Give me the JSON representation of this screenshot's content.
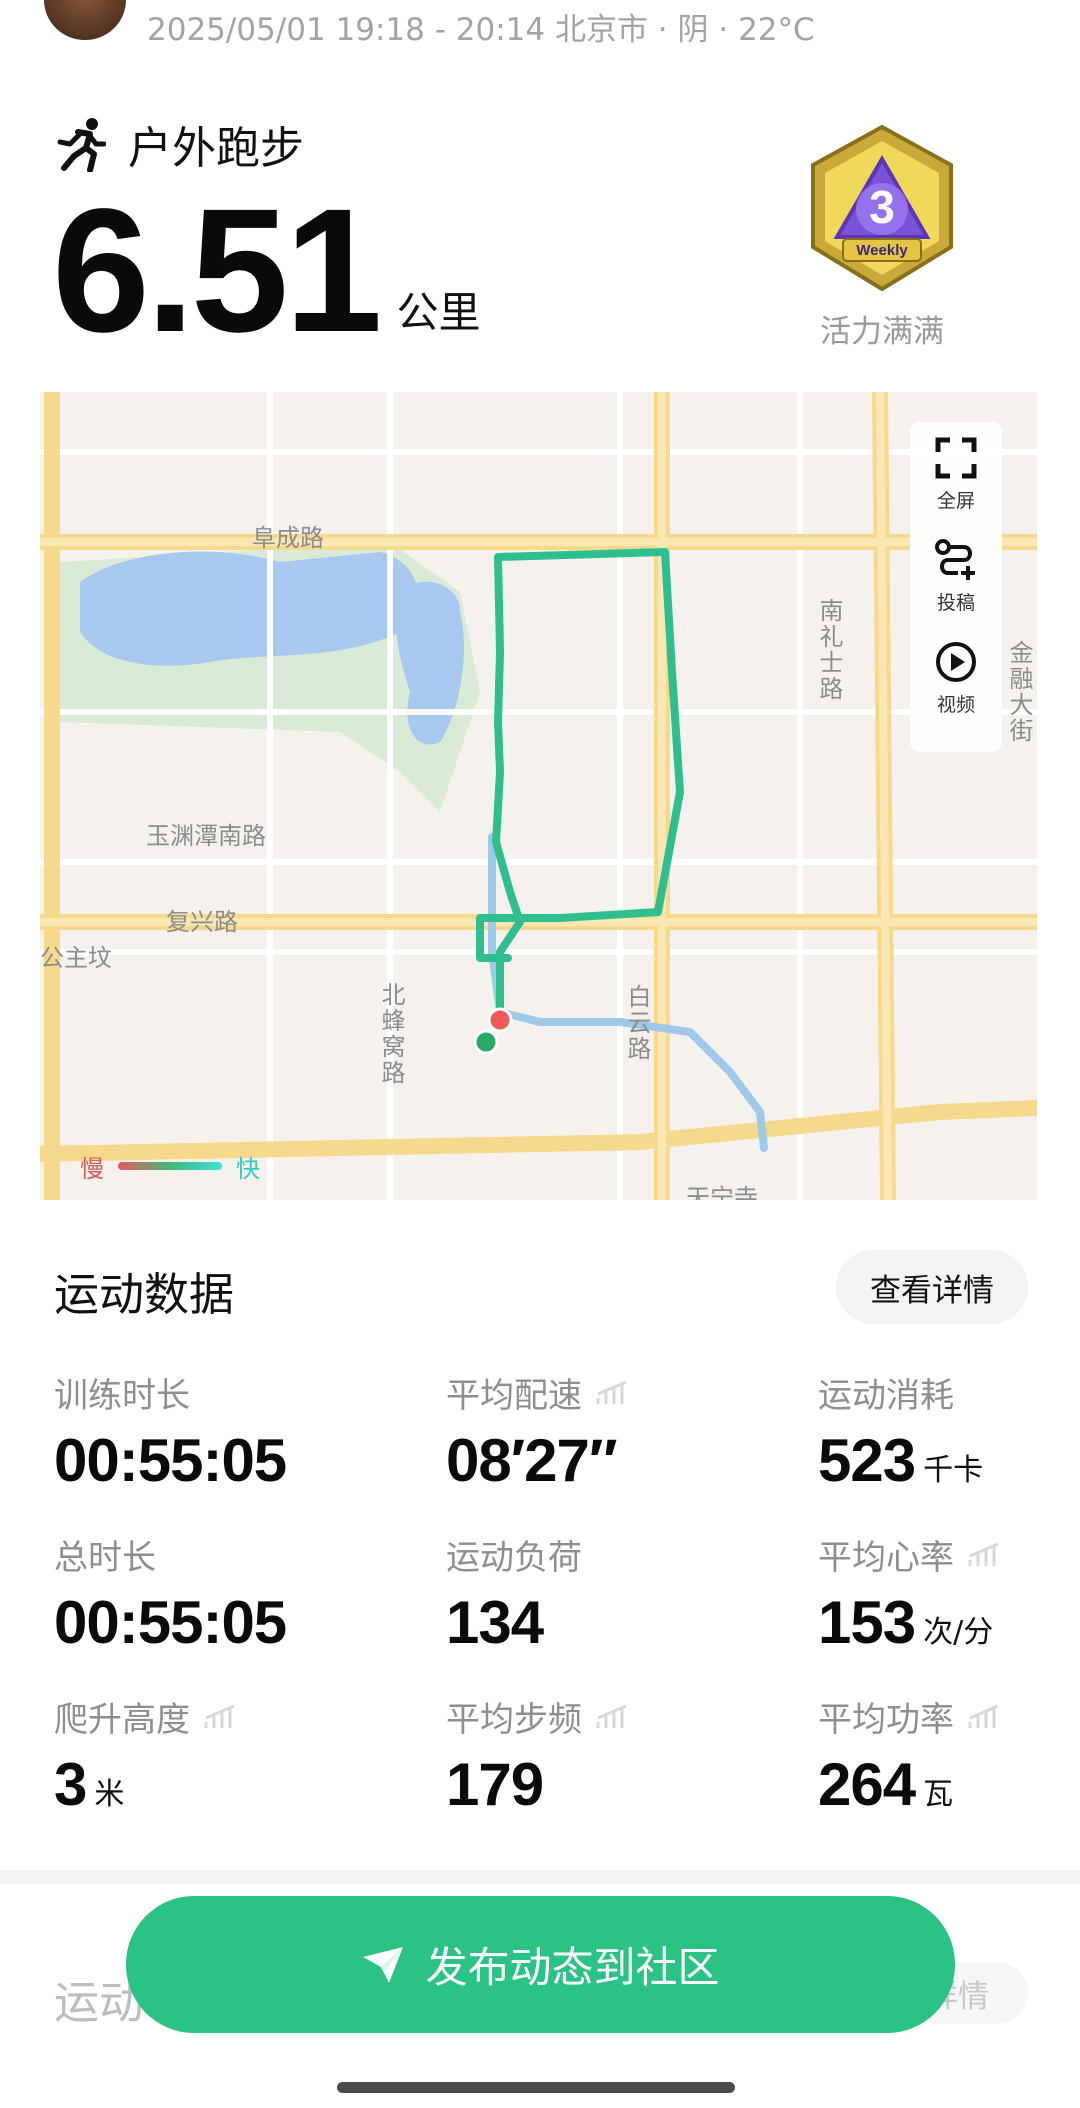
{
  "header": {
    "meta": "2025/05/01 19:18 - 20:14 北京市 · 阴 · 22°C"
  },
  "workout": {
    "type_label": "户外跑步",
    "distance_value": "6.51",
    "distance_unit": "公里"
  },
  "badge": {
    "text": "Weekly",
    "number": "3",
    "label": "活力满满"
  },
  "map": {
    "controls": [
      {
        "label": "全屏",
        "icon": "fullscreen-icon"
      },
      {
        "label": "投稿",
        "icon": "route-share-icon"
      },
      {
        "label": "视频",
        "icon": "play-video-icon"
      }
    ],
    "road_labels": {
      "fucheng": "阜成路",
      "yuyuantan": "玉渊潭南路",
      "fuxing": "复兴路",
      "gongzhufen": "公主坟",
      "beifengwo": "北蜂窝路",
      "baiyun": "白云路",
      "nanlishi": "南礼士路",
      "jinrong": "金融大街",
      "tianning": "天宁寺"
    },
    "legend": {
      "slow": "慢",
      "fast": "快"
    },
    "colors": {
      "route_green": "#2fbf8f",
      "route_blue": "#9ec9e8",
      "start": "#2aa86a",
      "end": "#ef5a5a"
    }
  },
  "stats": {
    "section_title": "运动数据",
    "detail_button": "查看详情",
    "items": [
      {
        "label": "训练时长",
        "value": "00:55:05",
        "unit": ""
      },
      {
        "label": "平均配速",
        "value": "08′27″",
        "unit": ""
      },
      {
        "label": "运动消耗",
        "value": "523",
        "unit": "千卡"
      },
      {
        "label": "总时长",
        "value": "00:55:05",
        "unit": ""
      },
      {
        "label": "运动负荷",
        "value": "134",
        "unit": ""
      },
      {
        "label": "平均心率",
        "value": "153",
        "unit": "次/分"
      },
      {
        "label": "爬升高度",
        "value": "3",
        "unit": "米"
      },
      {
        "label": "平均步频",
        "value": "179",
        "unit": ""
      },
      {
        "label": "平均功率",
        "value": "264",
        "unit": "瓦"
      }
    ]
  },
  "section2": {
    "title": "运动",
    "detail": "详情"
  },
  "publish": {
    "label": "发布动态到社区",
    "icon": "send-icon",
    "color": "#2ac384"
  }
}
